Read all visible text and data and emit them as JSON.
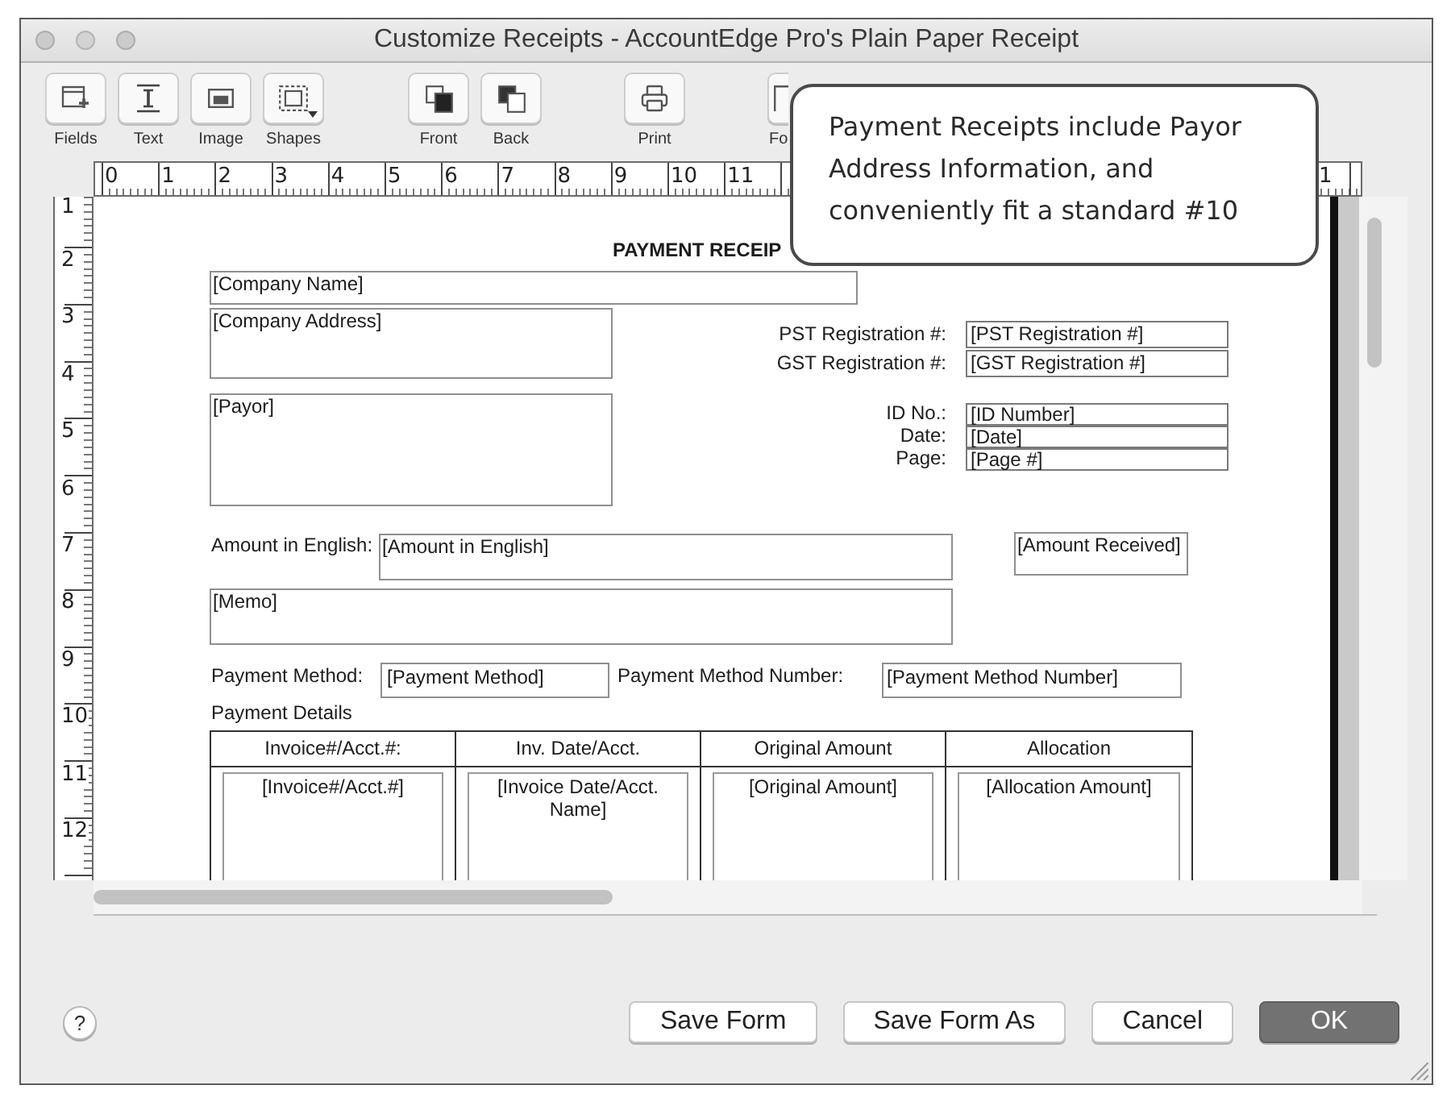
{
  "window": {
    "title": "Customize Receipts - AccountEdge Pro's Plain Paper Receipt"
  },
  "toolbar": [
    {
      "items": [
        {
          "label": "Fields",
          "kind": "fields"
        },
        {
          "label": "Text",
          "kind": "text"
        },
        {
          "label": "Image",
          "kind": "image"
        },
        {
          "label": "Shapes",
          "kind": "shapes"
        }
      ]
    },
    {
      "items": [
        {
          "label": "Front",
          "kind": "front"
        },
        {
          "label": "Back",
          "kind": "back"
        }
      ]
    },
    {
      "items": [
        {
          "label": "Print",
          "kind": "print"
        }
      ]
    },
    {
      "items": [
        {
          "label": "Fo",
          "kind": "document"
        }
      ]
    }
  ],
  "callout": {
    "text": "Payment Receipts include Payor Address Information, and conveniently fit a standard #10"
  },
  "rulers": {
    "horizontal": [
      "0",
      "1",
      "2",
      "3",
      "4",
      "5",
      "6",
      "7",
      "8",
      "9",
      "10",
      "11"
    ],
    "horizontal_end": "1",
    "vertical": [
      "1",
      "2",
      "3",
      "4",
      "5",
      "6",
      "7",
      "8",
      "9",
      "10",
      "11",
      "12"
    ]
  },
  "form": {
    "heading": "PAYMENT RECEIP",
    "company_name": "[Company Name]",
    "company_address": "[Company Address]",
    "registration": [
      {
        "label": "PST Registration #:",
        "field": "[PST Registration #]"
      },
      {
        "label": "GST Registration #:",
        "field": "[GST Registration #]"
      }
    ],
    "payor": "[Payor]",
    "receipt_info": [
      {
        "label": "ID No.:",
        "field": "[ID Number]"
      },
      {
        "label": "Date:",
        "field": "[Date]"
      },
      {
        "label": "Page:",
        "field": "[Page #]"
      }
    ],
    "amount_in_english": {
      "label": "Amount in English:",
      "field": "[Amount in English]"
    },
    "amount_received": "[Amount Received]",
    "memo": "[Memo]",
    "payment_method": {
      "label": "Payment Method:",
      "field": "[Payment Method]"
    },
    "payment_method_number": {
      "label": "Payment Method Number:",
      "field": "[Payment Method Number]"
    },
    "details": {
      "title": "Payment Details",
      "columns": [
        "Invoice#/Acct.#:",
        "Inv. Date/Acct.",
        "Original Amount",
        "Allocation"
      ],
      "cells": [
        "[Invoice#/Acct.#]",
        "[Invoice Date/Acct. Name]",
        "[Original Amount]",
        "[Allocation Amount]"
      ]
    }
  },
  "help": "?",
  "buttons": [
    {
      "label": "Save Form",
      "kind": "normal"
    },
    {
      "label": "Save Form As",
      "kind": "normal"
    },
    {
      "label": "Cancel",
      "kind": "normal"
    },
    {
      "label": "OK",
      "kind": "default"
    }
  ]
}
